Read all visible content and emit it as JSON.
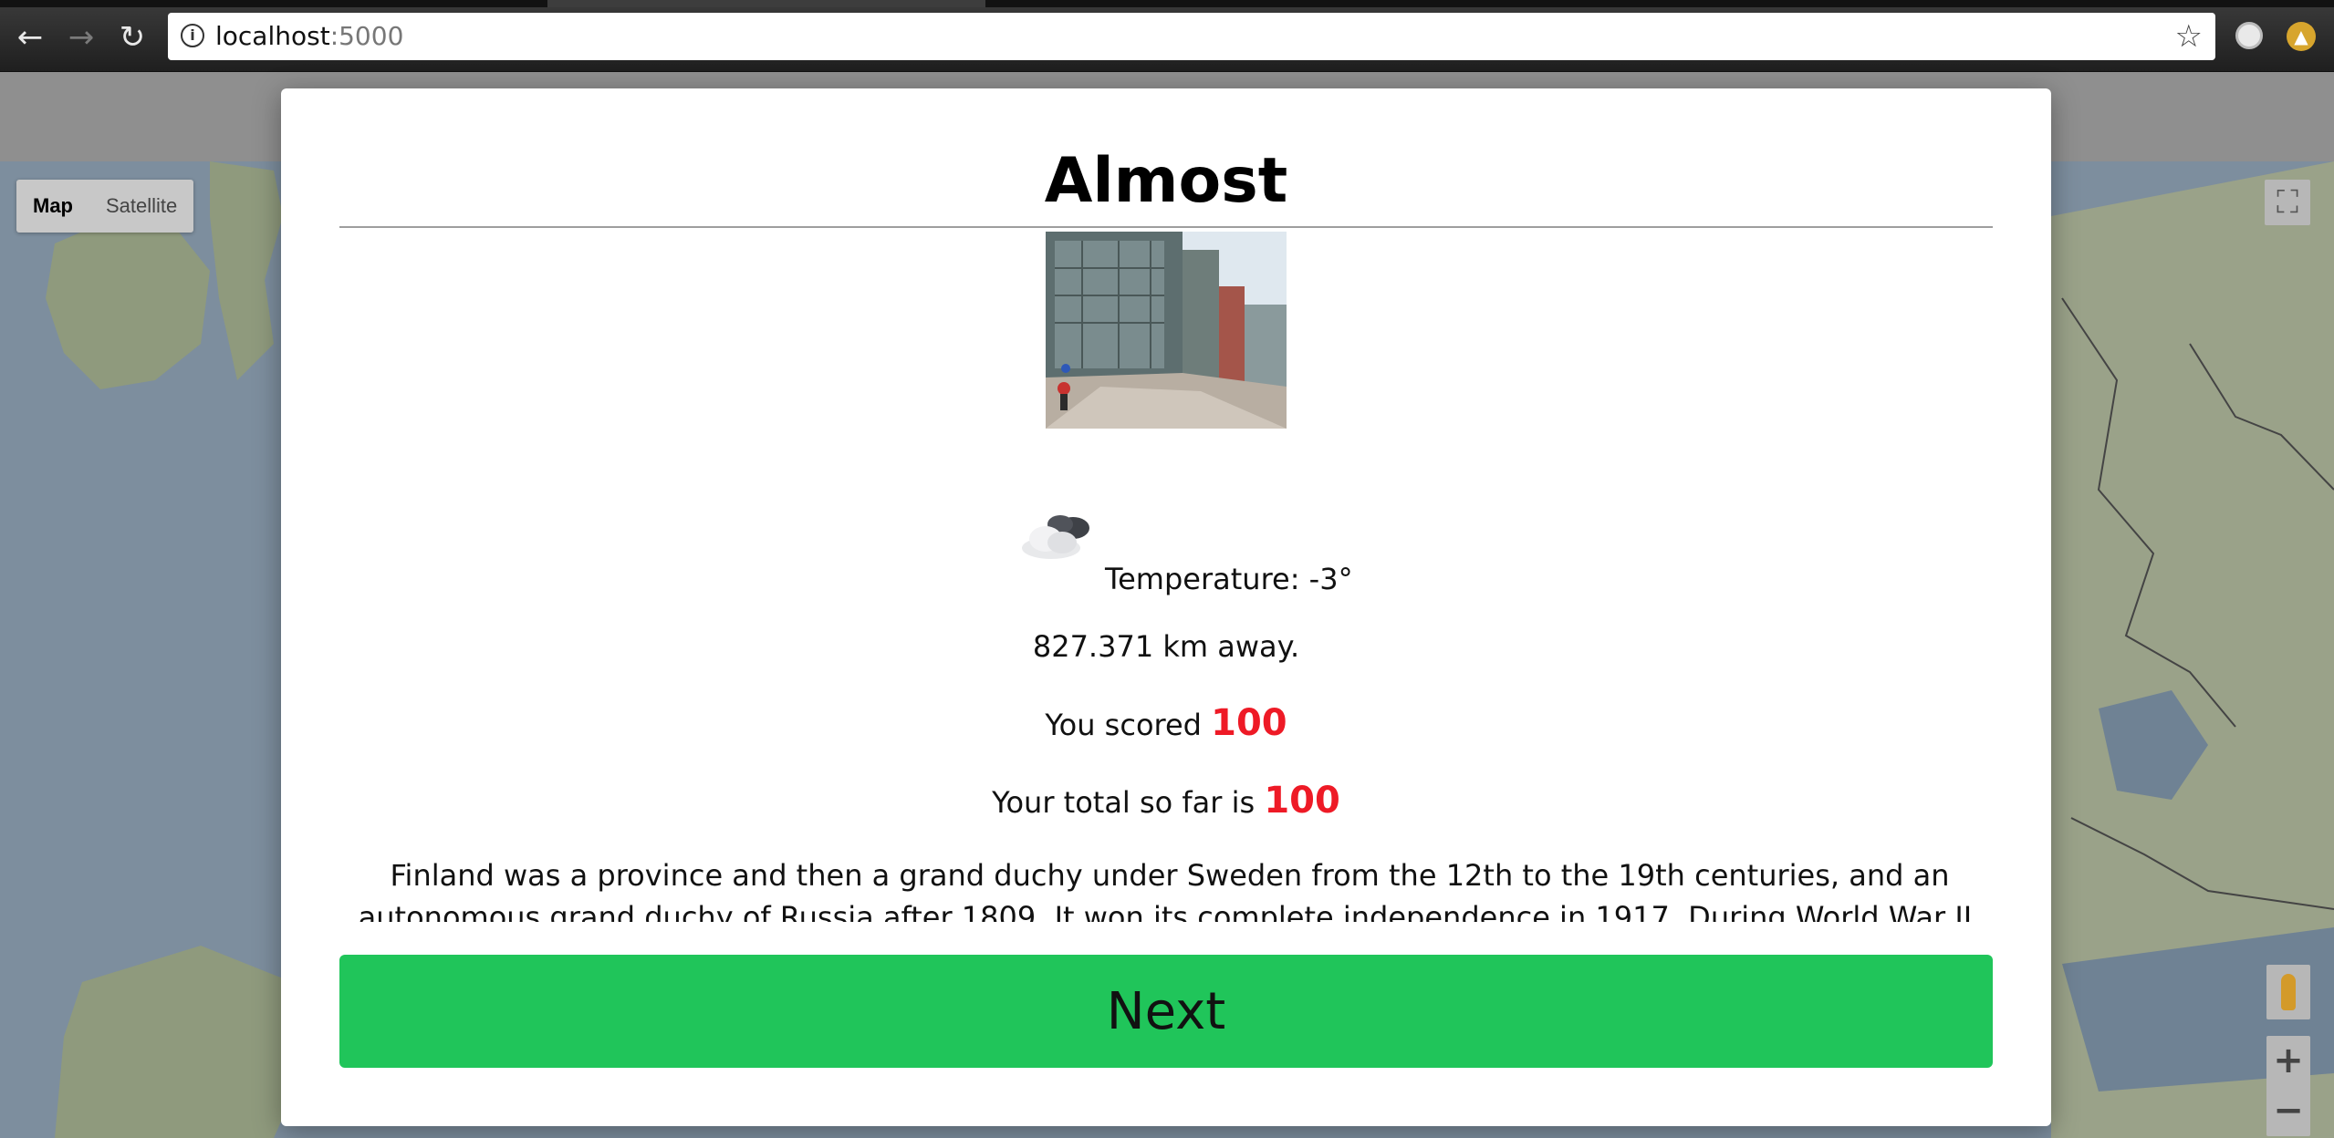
{
  "browser": {
    "url_host": "localhost",
    "url_port": ":5000",
    "back_icon": "arrow-left-icon",
    "forward_icon": "arrow-right-icon",
    "reload_icon": "reload-icon",
    "bookmark_icon": "star-icon"
  },
  "map": {
    "type_map_label": "Map",
    "type_satellite_label": "Satellite"
  },
  "modal": {
    "title": "Almost",
    "temperature_text": "Temperature: -3°",
    "distance_text": "827.371 km away.",
    "score_prefix": "You scored",
    "score_value": "100",
    "total_prefix": "Your total so far is",
    "total_value": "100",
    "description": "Finland was a province and then a grand duchy under Sweden from the 12th to the 19th centuries, and an autonomous grand duchy of Russia after 1809. It won its complete independence in 1917. During World War II, it was able to successfully defend",
    "next_label": "Next",
    "score_color": "#ee1a26",
    "button_color": "#20c55a"
  }
}
